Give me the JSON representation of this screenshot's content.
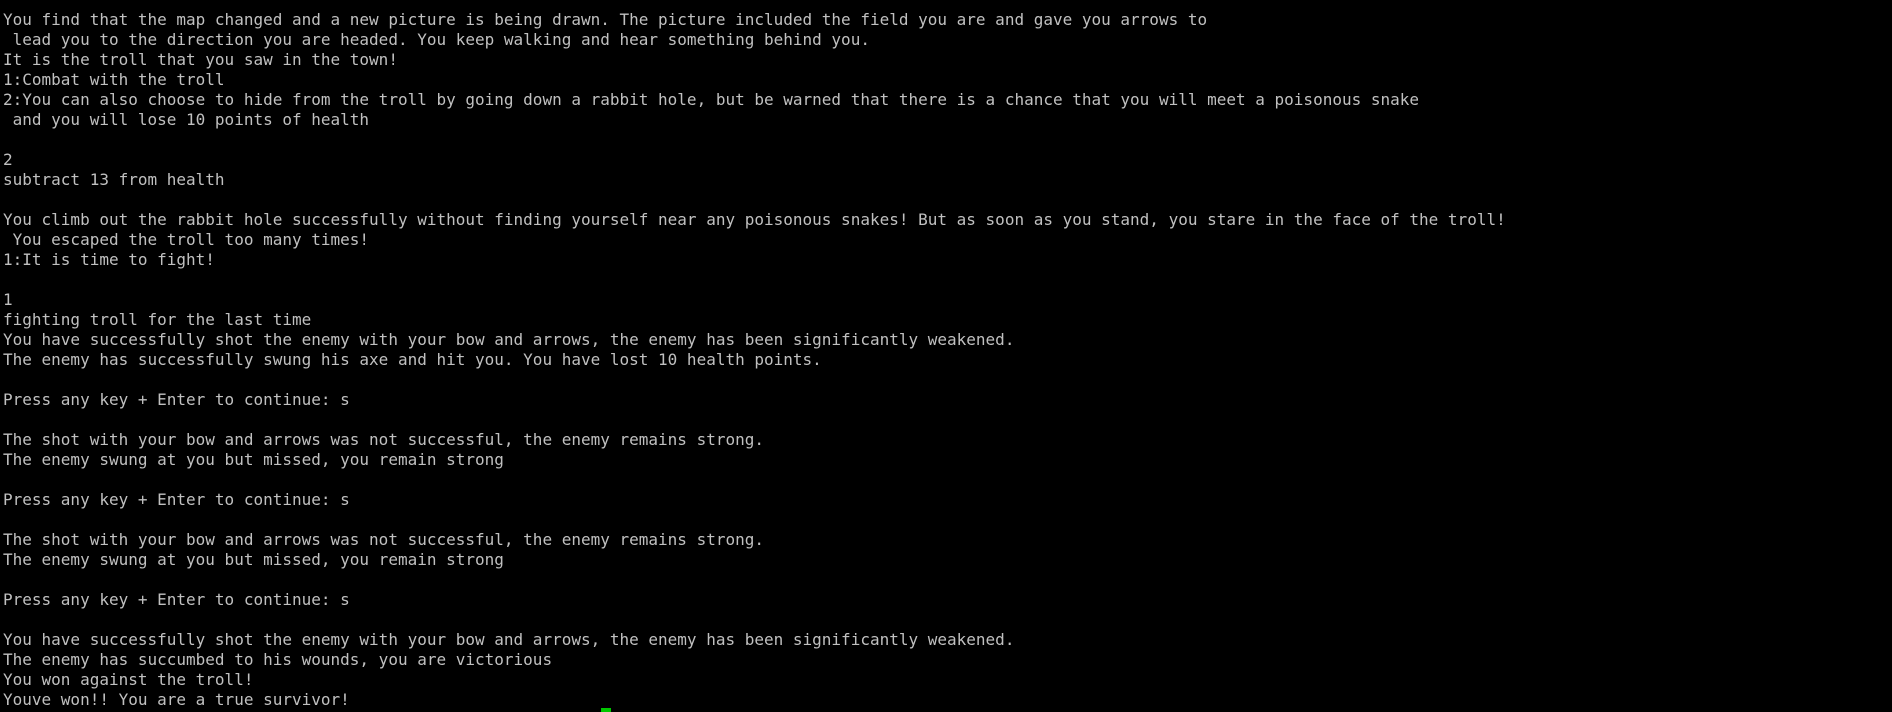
{
  "terminal": {
    "lines": [
      "You find that the map changed and a new picture is being drawn. The picture included the field you are and gave you arrows to",
      " lead you to the direction you are headed. You keep walking and hear something behind you.",
      "It is the troll that you saw in the town!",
      "1:Combat with the troll",
      "2:You can also choose to hide from the troll by going down a rabbit hole, but be warned that there is a chance that you will meet a poisonous snake",
      " and you will lose 10 points of health",
      "",
      "2",
      "subtract 13 from health",
      "",
      "You climb out the rabbit hole successfully without finding yourself near any poisonous snakes! But as soon as you stand, you stare in the face of the troll!",
      " You escaped the troll too many times!",
      "1:It is time to fight!",
      "",
      "1",
      "fighting troll for the last time",
      "You have successfully shot the enemy with your bow and arrows, the enemy has been significantly weakened.",
      "The enemy has successfully swung his axe and hit you. You have lost 10 health points.",
      "",
      "Press any key + Enter to continue: s",
      "",
      "The shot with your bow and arrows was not successful, the enemy remains strong.",
      "The enemy swung at you but missed, you remain strong",
      "",
      "Press any key + Enter to continue: s",
      "",
      "The shot with your bow and arrows was not successful, the enemy remains strong.",
      "The enemy swung at you but missed, you remain strong",
      "",
      "Press any key + Enter to continue: s",
      "",
      "You have successfully shot the enemy with your bow and arrows, the enemy has been significantly weakened.",
      "The enemy has succumbed to his wounds, you are victorious",
      "You won against the troll!",
      "Youve won!! You are a true survivor!"
    ]
  },
  "colors": {
    "background": "#000000",
    "text": "#c0c0c0",
    "cursor": "#00c800"
  }
}
